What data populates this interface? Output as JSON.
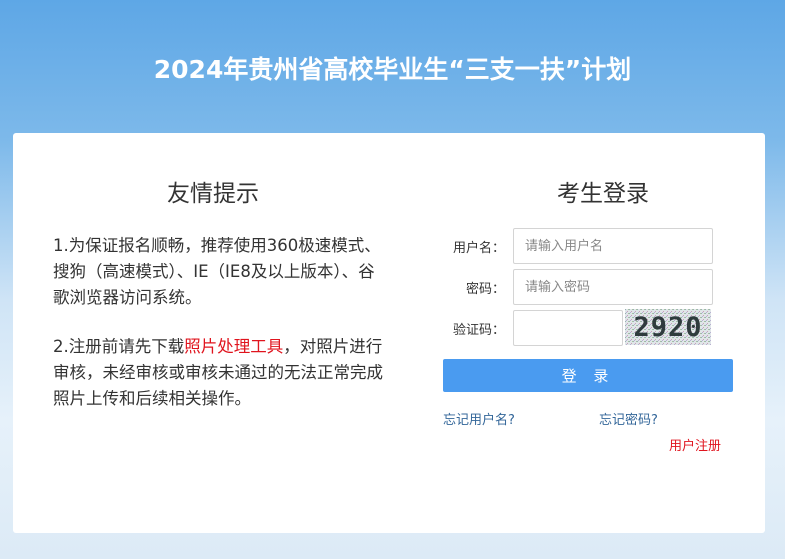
{
  "header": {
    "title": "2024年贵州省高校毕业生“三支一扶”计划"
  },
  "tips": {
    "title": "友情提示",
    "item1": "1.为保证报名顺畅，推荐使用360极速模式、搜狗（高速模式）、IE（IE8及以上版本）、谷歌浏览器访问系统。",
    "item2_before": "2.注册前请先下载",
    "item2_link": "照片处理工具",
    "item2_after": "，对照片进行审核，未经审核或审核未通过的无法正常完成照片上传和后续相关操作。"
  },
  "login": {
    "title": "考生登录",
    "username_label": "用户名：",
    "username_placeholder": "请输入用户名",
    "password_label": "密码：",
    "password_placeholder": "请输入密码",
    "captcha_label": "验证码：",
    "captcha_value": "",
    "captcha_text": "2920",
    "submit_label": "登 录",
    "forgot_username": "忘记用户名?",
    "forgot_password": "忘记密码?",
    "register": "用户注册"
  },
  "colors": {
    "accent": "#4a9bf0",
    "link": "#336699",
    "highlight": "#e0141e"
  }
}
